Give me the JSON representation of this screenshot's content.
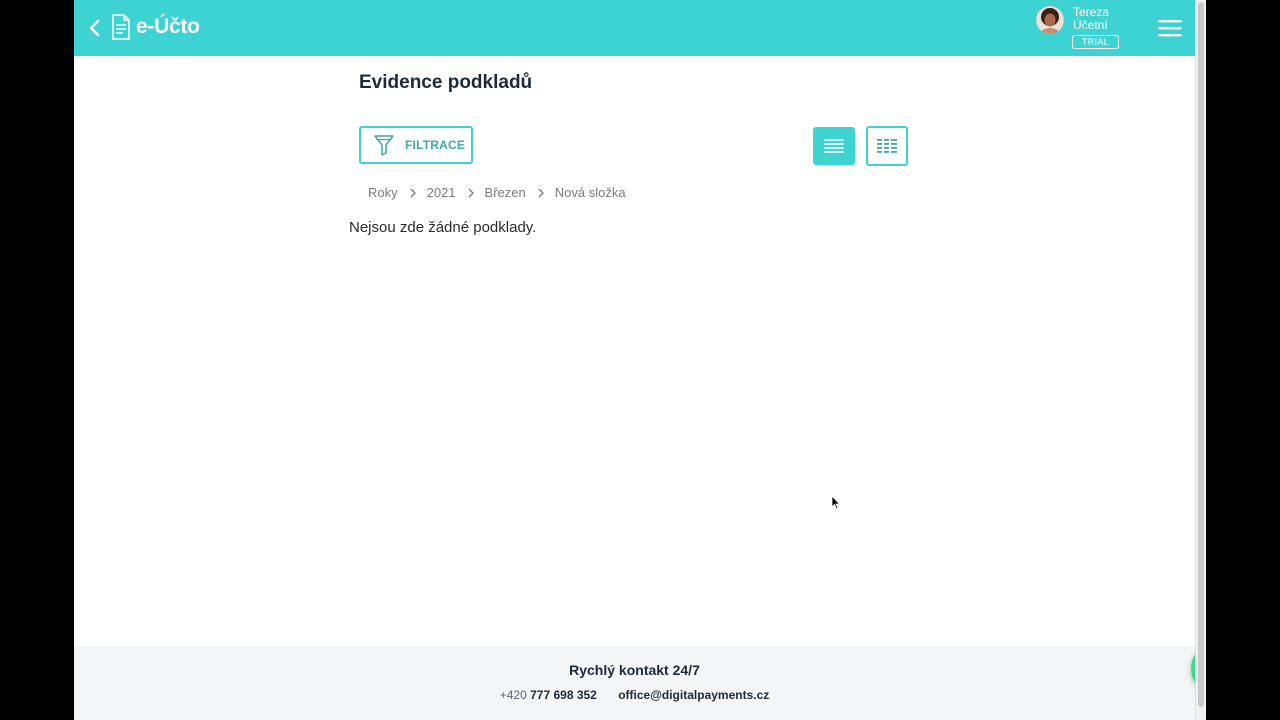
{
  "header": {
    "logo_text": "e-Účto",
    "user_first_name": "Tereza",
    "user_last_name": "Účetní",
    "plan_badge": "TRIAL",
    "accent_color": "#3dd3d3"
  },
  "main": {
    "title": "Evidence podkladů",
    "filter_label": "FILTRACE",
    "breadcrumb": [
      "Roky",
      "2021",
      "Březen",
      "Nová složka"
    ],
    "empty_message": "Nejsou zde žádné podklady."
  },
  "footer": {
    "title": "Rychlý kontakt 24/7",
    "phone_prefix": "+420",
    "phone_number": "777 698 352",
    "email": "office@digitalpayments.cz"
  },
  "fab": {
    "icon": "plus-icon",
    "color": "#2ee38e"
  },
  "icons": [
    "back-chevron-icon",
    "document-icon",
    "hamburger-menu-icon",
    "funnel-icon",
    "list-view-icon",
    "grid-view-icon",
    "chevron-right-icon",
    "plus-icon"
  ]
}
